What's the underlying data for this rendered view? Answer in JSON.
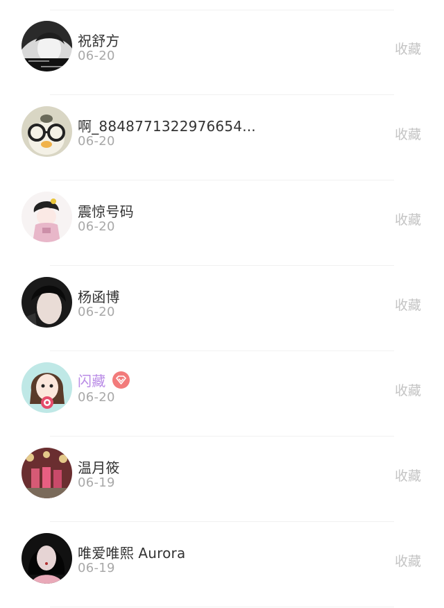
{
  "collect_label": "收藏",
  "users": [
    {
      "name": "祝舒方",
      "date": "06-20",
      "vip": false,
      "avatar_text": [
        "说我太乖别",
        "谁人爱我",
        "(dunno)"
      ]
    },
    {
      "name": "啊_8848771322976654...",
      "date": "06-20",
      "vip": false
    },
    {
      "name": "震惊号码",
      "date": "06-20",
      "vip": false
    },
    {
      "name": "杨函博",
      "date": "06-20",
      "vip": false
    },
    {
      "name": "闪藏",
      "date": "06-20",
      "vip": true,
      "badge_icon": "diamond-icon"
    },
    {
      "name": "温月筱",
      "date": "06-19",
      "vip": false
    },
    {
      "name": "唯爱唯熙 Aurora",
      "date": "06-19",
      "vip": false
    }
  ],
  "colors": {
    "name": "#333333",
    "vip_name": "#b98be6",
    "date": "#a8a8a8",
    "action": "#c4c4c4",
    "vip_badge": "#f27b7b"
  }
}
